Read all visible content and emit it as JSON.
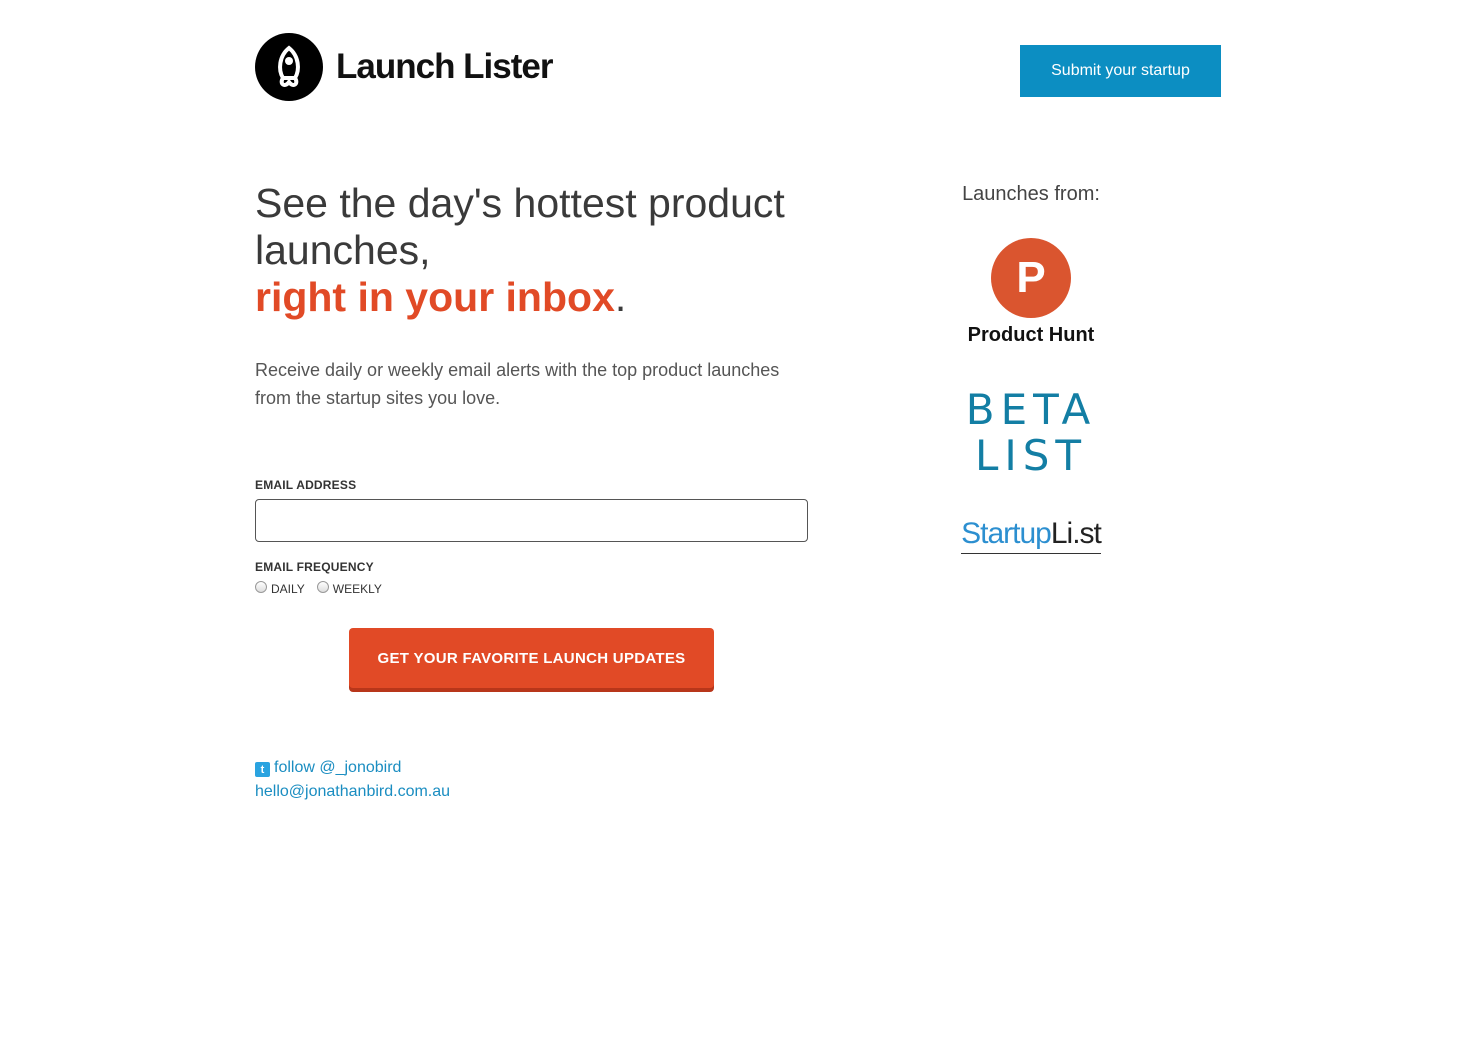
{
  "header": {
    "brand": "Launch Lister",
    "submit_label": "Submit your startup"
  },
  "hero": {
    "headline_main": "See the day's hottest product launches,",
    "headline_accent": "right in your inbox",
    "headline_end": ".",
    "subtext": "Receive daily or weekly email alerts with the top product launches from the startup sites you love."
  },
  "form": {
    "email_label": "Email Address",
    "email_value": "",
    "email_placeholder": "",
    "frequency_label": "Email Frequency",
    "options": [
      "Daily",
      "Weekly"
    ],
    "submit_label": "Get your favorite launch updates"
  },
  "footer": {
    "follow_label": "follow @_jonobird",
    "email": "hello@jonathanbird.com.au"
  },
  "sidebar": {
    "title": "Launches from:",
    "producthunt": {
      "letter": "P",
      "name": "Product Hunt"
    },
    "betalist_line1": "BETA",
    "betalist_line2": "LIST",
    "startuplist_a": "Startup",
    "startuplist_b": "Li.st"
  },
  "colors": {
    "accent": "#e14a26",
    "blue_button": "#0c8ec2",
    "link": "#1a8dc1",
    "producthunt": "#da552f",
    "betalist": "#137ea4"
  }
}
